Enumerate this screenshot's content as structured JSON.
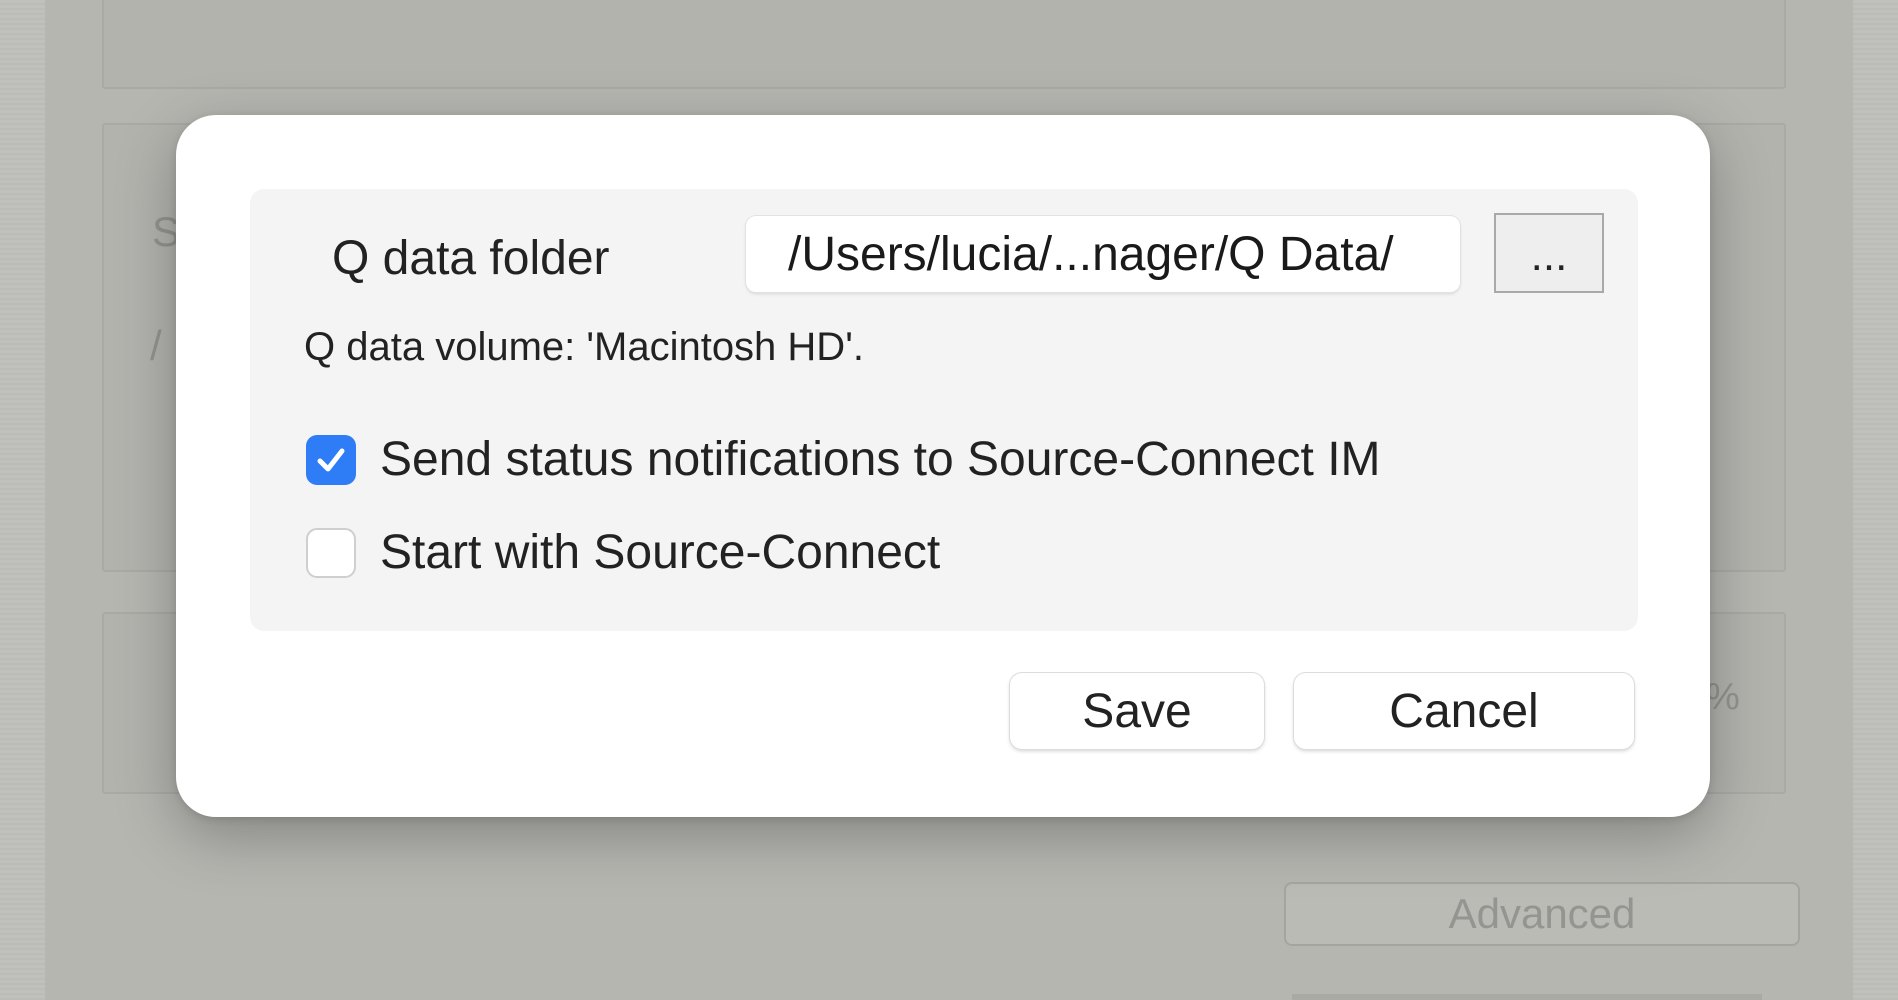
{
  "background": {
    "partial_letter_s": "S",
    "partial_slash": "/",
    "partial_percent": "%",
    "advanced_label": "Advanced"
  },
  "dialog": {
    "folder_label": "Q data folder",
    "folder_path": "/Users/lucia/...nager/Q Data/",
    "browse_label": "...",
    "volume_text": "Q data volume: 'Macintosh HD'.",
    "options": [
      {
        "label": "Send status notifications to Source-Connect IM",
        "checked": true
      },
      {
        "label": "Start with Source-Connect",
        "checked": false
      }
    ],
    "save_label": "Save",
    "cancel_label": "Cancel"
  },
  "colors": {
    "accent": "#2e7cf6",
    "dialog_bg": "#ffffff",
    "panel_bg": "#f4f4f4"
  }
}
